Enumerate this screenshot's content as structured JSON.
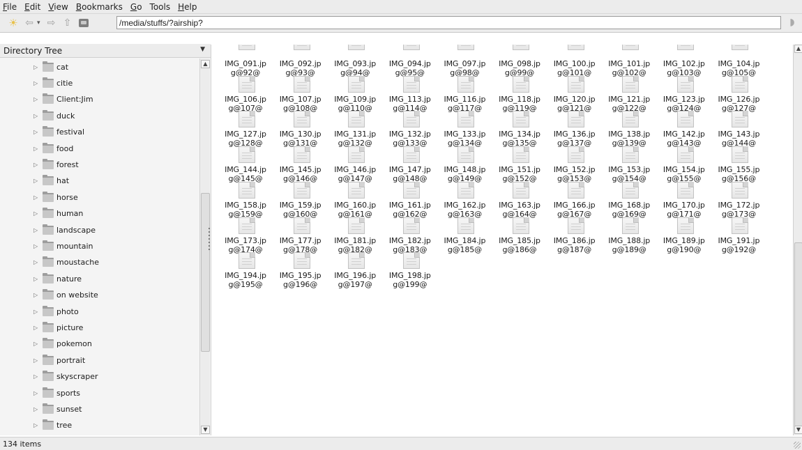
{
  "menubar": {
    "items": [
      {
        "label": "File",
        "mnemonic": "F"
      },
      {
        "label": "Edit",
        "mnemonic": "E"
      },
      {
        "label": "View",
        "mnemonic": "V"
      },
      {
        "label": "Bookmarks",
        "mnemonic": "B"
      },
      {
        "label": "Go",
        "mnemonic": "G"
      },
      {
        "label": "Tools",
        "mnemonic": ""
      },
      {
        "label": "Help",
        "mnemonic": "H"
      }
    ]
  },
  "toolbar": {
    "new_tab_icon": "new-tab-icon",
    "back_icon": "back-arrow-icon",
    "forward_icon": "forward-arrow-icon",
    "up_icon": "up-arrow-icon",
    "drive_icon": "drive-icon",
    "location_value": "/media/stuffs/?airship?",
    "clear_icon": "clear-icon"
  },
  "sidebar": {
    "header": "Directory Tree",
    "items": [
      "cat",
      "citie",
      "Client:Jim",
      "duck",
      "festival",
      "food",
      "forest",
      "hat",
      "horse",
      "human",
      "landscape",
      "mountain",
      "moustache",
      "nature",
      "on website",
      "photo",
      "picture",
      "pokemon",
      "portrait",
      "skyscraper",
      "sports",
      "sunset",
      "tree"
    ]
  },
  "files": [
    [
      "IMG_091.jp",
      "g@92@"
    ],
    [
      "IMG_092.jp",
      "g@93@"
    ],
    [
      "IMG_093.jp",
      "g@94@"
    ],
    [
      "IMG_094.jp",
      "g@95@"
    ],
    [
      "IMG_097.jp",
      "g@98@"
    ],
    [
      "IMG_098.jp",
      "g@99@"
    ],
    [
      "IMG_100.jp",
      "g@101@"
    ],
    [
      "IMG_101.jp",
      "g@102@"
    ],
    [
      "IMG_102.jp",
      "g@103@"
    ],
    [
      "IMG_104.jp",
      "g@105@"
    ],
    [
      "IMG_106.jp",
      "g@107@"
    ],
    [
      "IMG_107.jp",
      "g@108@"
    ],
    [
      "IMG_109.jp",
      "g@110@"
    ],
    [
      "IMG_113.jp",
      "g@114@"
    ],
    [
      "IMG_116.jp",
      "g@117@"
    ],
    [
      "IMG_118.jp",
      "g@119@"
    ],
    [
      "IMG_120.jp",
      "g@121@"
    ],
    [
      "IMG_121.jp",
      "g@122@"
    ],
    [
      "IMG_123.jp",
      "g@124@"
    ],
    [
      "IMG_126.jp",
      "g@127@"
    ],
    [
      "IMG_127.jp",
      "g@128@"
    ],
    [
      "IMG_130.jp",
      "g@131@"
    ],
    [
      "IMG_131.jp",
      "g@132@"
    ],
    [
      "IMG_132.jp",
      "g@133@"
    ],
    [
      "IMG_133.jp",
      "g@134@"
    ],
    [
      "IMG_134.jp",
      "g@135@"
    ],
    [
      "IMG_136.jp",
      "g@137@"
    ],
    [
      "IMG_138.jp",
      "g@139@"
    ],
    [
      "IMG_142.jp",
      "g@143@"
    ],
    [
      "IMG_143.jp",
      "g@144@"
    ],
    [
      "IMG_144.jp",
      "g@145@"
    ],
    [
      "IMG_145.jp",
      "g@146@"
    ],
    [
      "IMG_146.jp",
      "g@147@"
    ],
    [
      "IMG_147.jp",
      "g@148@"
    ],
    [
      "IMG_148.jp",
      "g@149@"
    ],
    [
      "IMG_151.jp",
      "g@152@"
    ],
    [
      "IMG_152.jp",
      "g@153@"
    ],
    [
      "IMG_153.jp",
      "g@154@"
    ],
    [
      "IMG_154.jp",
      "g@155@"
    ],
    [
      "IMG_155.jp",
      "g@156@"
    ],
    [
      "IMG_158.jp",
      "g@159@"
    ],
    [
      "IMG_159.jp",
      "g@160@"
    ],
    [
      "IMG_160.jp",
      "g@161@"
    ],
    [
      "IMG_161.jp",
      "g@162@"
    ],
    [
      "IMG_162.jp",
      "g@163@"
    ],
    [
      "IMG_163.jp",
      "g@164@"
    ],
    [
      "IMG_166.jp",
      "g@167@"
    ],
    [
      "IMG_168.jp",
      "g@169@"
    ],
    [
      "IMG_170.jp",
      "g@171@"
    ],
    [
      "IMG_172.jp",
      "g@173@"
    ],
    [
      "IMG_173.jp",
      "g@174@"
    ],
    [
      "IMG_177.jp",
      "g@178@"
    ],
    [
      "IMG_181.jp",
      "g@182@"
    ],
    [
      "IMG_182.jp",
      "g@183@"
    ],
    [
      "IMG_184.jp",
      "g@185@"
    ],
    [
      "IMG_185.jp",
      "g@186@"
    ],
    [
      "IMG_186.jp",
      "g@187@"
    ],
    [
      "IMG_188.jp",
      "g@189@"
    ],
    [
      "IMG_189.jp",
      "g@190@"
    ],
    [
      "IMG_191.jp",
      "g@192@"
    ],
    [
      "IMG_194.jp",
      "g@195@"
    ],
    [
      "IMG_195.jp",
      "g@196@"
    ],
    [
      "IMG_196.jp",
      "g@197@"
    ],
    [
      "IMG_198.jp",
      "g@199@"
    ]
  ],
  "status": {
    "text": "134 items"
  }
}
